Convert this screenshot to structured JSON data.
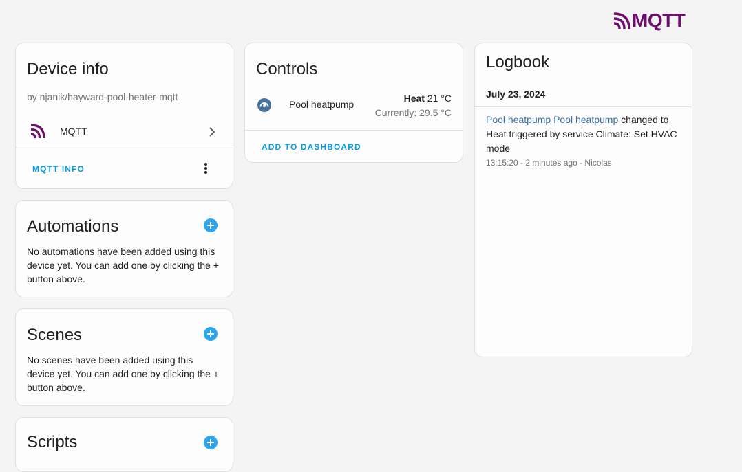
{
  "brand": {
    "name": "MQTT",
    "color": "#6e0f6e"
  },
  "device_info": {
    "title": "Device info",
    "by": "by njanik/hayward-pool-heater-mqtt",
    "integration": "MQTT",
    "action": "MQTT INFO"
  },
  "automations": {
    "title": "Automations",
    "empty_text": "No automations have been added using this device yet. You can add one by clicking the + button above."
  },
  "scenes": {
    "title": "Scenes",
    "empty_text": "No scenes have been added using this device yet. You can add one by clicking the + button above."
  },
  "scripts": {
    "title": "Scripts"
  },
  "controls": {
    "title": "Controls",
    "entity": {
      "name": "Pool heatpump",
      "mode": "Heat",
      "target": "21 °C",
      "current": "Currently: 29.5 °C"
    },
    "action": "ADD TO DASHBOARD"
  },
  "logbook": {
    "title": "Logbook",
    "date": "July 23, 2024",
    "entry": {
      "link1": "Pool heatpump",
      "link2": "Pool heatpump",
      "message": " changed to Heat triggered by service Climate: Set HVAC mode",
      "meta": "13:15:20 - 2 minutes ago - Nicolas"
    }
  },
  "colors": {
    "accent": "#039be5",
    "add_button": "#2ba6ee",
    "link": "#3a6ea5"
  }
}
